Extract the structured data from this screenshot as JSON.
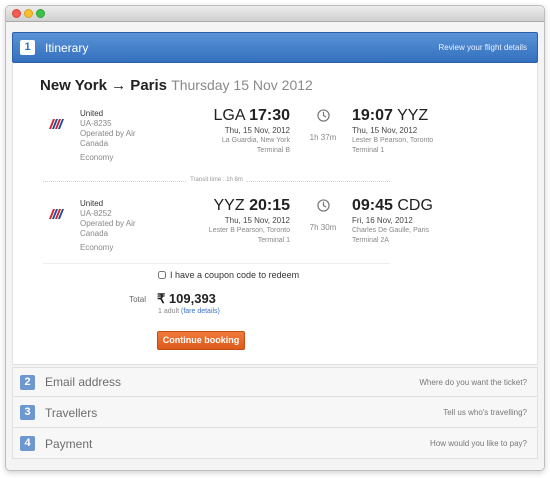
{
  "window": {
    "title": ""
  },
  "steps": [
    {
      "num": "1",
      "title": "Itinerary",
      "hint": "Review your flight details"
    },
    {
      "num": "2",
      "title": "Email address",
      "hint": "Where do you want the ticket?"
    },
    {
      "num": "3",
      "title": "Travellers",
      "hint": "Tell us who's travelling?"
    },
    {
      "num": "4",
      "title": "Payment",
      "hint": "How would you like to pay?"
    }
  ],
  "itinerary": {
    "route": "New York → Paris",
    "date": "Thursday 15 Nov 2012",
    "segments": [
      {
        "airline": "United",
        "flight": "UA-8235",
        "operated": "Operated by Air Canada",
        "cabin": "Economy",
        "dep_code": "LGA",
        "dep_time": "17:30",
        "dep_date": "Thu, 15 Nov, 2012",
        "dep_airport": "La Guardia, New York",
        "dep_terminal": "Terminal B",
        "duration": "1h 37m",
        "arr_time": "19:07",
        "arr_code": "YYZ",
        "arr_date": "Thu, 15 Nov, 2012",
        "arr_airport": "Lester B Pearson, Toronto",
        "arr_terminal": "Terminal 1"
      },
      {
        "airline": "United",
        "flight": "UA-8252",
        "operated": "Operated by Air Canada",
        "cabin": "Economy",
        "dep_code": "YYZ",
        "dep_time": "20:15",
        "dep_date": "Thu, 15 Nov, 2012",
        "dep_airport": "Lester B Pearson, Toronto",
        "dep_terminal": "Terminal 1",
        "duration": "7h 30m",
        "arr_time": "09:45",
        "arr_code": "CDG",
        "arr_date": "Fri, 16 Nov, 2012",
        "arr_airport": "Charles De Gaulle, Paris",
        "arr_terminal": "Terminal 2A"
      }
    ],
    "transit": "Transit time : 1h 8m",
    "coupon_label": "I have a coupon code to redeem",
    "total_label": "Total",
    "total_currency": "₹",
    "total_amount": "109,393",
    "total_travellers": "1 adult",
    "fare_details": "(fare details)",
    "cta": "Continue booking"
  },
  "colors": {
    "accent": "#3370bf",
    "cta": "#e2621f",
    "link": "#3b74c4",
    "airline_red": "#d2232a",
    "airline_blue": "#1f4ea1"
  },
  "icons": {
    "airline": "united-tulip-logo",
    "duration": "clock-icon"
  }
}
